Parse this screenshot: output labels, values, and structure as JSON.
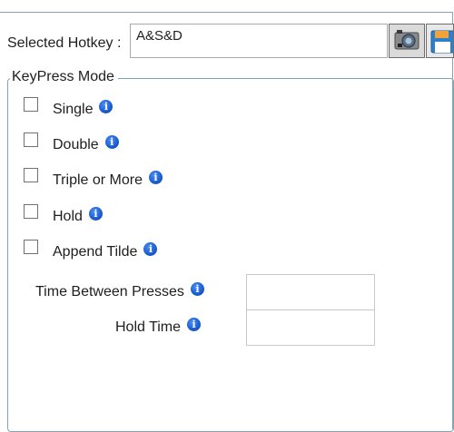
{
  "hotkey": {
    "label": "Selected Hotkey :",
    "value": "A&S&D",
    "record_icon": "camera-record-icon",
    "save_icon": "floppy-save-icon"
  },
  "keypress_mode": {
    "legend": "KeyPress Mode",
    "options": [
      {
        "label": "Single",
        "checked": false
      },
      {
        "label": "Double",
        "checked": false
      },
      {
        "label": "Triple or More",
        "checked": false
      },
      {
        "label": "Hold",
        "checked": false
      },
      {
        "label": "Append Tilde",
        "checked": false
      }
    ],
    "info_icon": "info-icon",
    "time_between_presses": {
      "label": "Time Between Presses",
      "value": ""
    },
    "hold_time": {
      "label": "Hold Time",
      "value": ""
    }
  },
  "colors": {
    "frame_border": "#7fa6b4",
    "info_blue": "#1b5fd6"
  }
}
